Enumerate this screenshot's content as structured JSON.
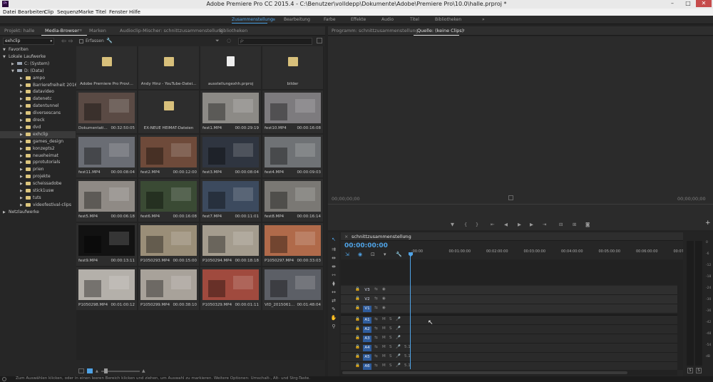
{
  "window": {
    "title": "Adobe Premiere Pro CC 2015.4 - C:\\Benutzer\\volldepp\\Dokumente\\Adobe\\Premiere Pro\\10.0\\halle.prproj *",
    "app_icon_label": "Pr",
    "minimize": "–",
    "maximize": "□",
    "close": "✕"
  },
  "menu": [
    "Datei",
    "Bearbeiten",
    "Clip",
    "Sequenz",
    "Marke",
    "Titel",
    "Fenster",
    "Hilfe"
  ],
  "workspaces": [
    "Zusammenstellung",
    "Bearbeitung",
    "Farbe",
    "Effekte",
    "Audio",
    "Titel",
    "Bibliotheken"
  ],
  "workspace_more": "»",
  "left_tabs": [
    "Projekt: halle",
    "Media-Browser",
    "Marken",
    "Audioclip-Mischer: schnittzusammenstellung",
    "Bibliotheken"
  ],
  "left_tab_menu": "≡",
  "right_tabs": [
    "Programm: schnittzusammenstellung",
    "Quelle: (keine Clips)"
  ],
  "right_tab_menu": "≡",
  "browser": {
    "path_value": "exhclip",
    "ingest_label": "Erfassen",
    "search_placeholder": "ρ·"
  },
  "tree": [
    {
      "label": "Favoriten",
      "level": 0,
      "arrow": "▼"
    },
    {
      "label": "Lokale Laufwerke",
      "level": 0,
      "arrow": "▼"
    },
    {
      "label": "C: (System)",
      "level": 1,
      "arrow": "▶"
    },
    {
      "label": "D: (Data)",
      "level": 1,
      "arrow": "▼"
    },
    {
      "label": "ampo",
      "level": 2,
      "arrow": "▶"
    },
    {
      "label": "Barrierefreiheit 2016",
      "level": 2,
      "arrow": "▶"
    },
    {
      "label": "datavideo",
      "level": 2,
      "arrow": "▶"
    },
    {
      "label": "datenetc",
      "level": 2,
      "arrow": "▶"
    },
    {
      "label": "datentunnel",
      "level": 2,
      "arrow": "▶"
    },
    {
      "label": "diversescans",
      "level": 2,
      "arrow": "▶"
    },
    {
      "label": "dreck",
      "level": 2,
      "arrow": "▶"
    },
    {
      "label": "dvd",
      "level": 2,
      "arrow": "▶"
    },
    {
      "label": "exhclip",
      "level": 2,
      "arrow": "▶",
      "selected": true
    },
    {
      "label": "games_design",
      "level": 2,
      "arrow": "▶"
    },
    {
      "label": "konzepts2",
      "level": 2,
      "arrow": "▶"
    },
    {
      "label": "neueheimat",
      "level": 2,
      "arrow": "▶"
    },
    {
      "label": "pprotutorials",
      "level": 2,
      "arrow": "▶"
    },
    {
      "label": "prien",
      "level": 2,
      "arrow": "▶"
    },
    {
      "label": "projekte",
      "level": 2,
      "arrow": "▶"
    },
    {
      "label": "scheissadobe",
      "level": 2,
      "arrow": "▶"
    },
    {
      "label": "stick1usw",
      "level": 2,
      "arrow": "▶"
    },
    {
      "label": "tuts",
      "level": 2,
      "arrow": "▶"
    },
    {
      "label": "videofestival-clips",
      "level": 2,
      "arrow": "▶"
    },
    {
      "label": "Netzlaufwerke",
      "level": 0,
      "arrow": "▶"
    }
  ],
  "items": [
    {
      "type": "folder",
      "name": "Adobe Premiere Pro Provi..."
    },
    {
      "type": "folder",
      "name": "Andy Hinz - YouTube-Datei..."
    },
    {
      "type": "project",
      "name": "ausstellungexhh.prproj"
    },
    {
      "type": "folder",
      "name": "bilder"
    },
    {
      "type": "clip",
      "name": "Dokumentati...",
      "dur": "00:32:50:05",
      "bg": "#5a4a44"
    },
    {
      "type": "folder",
      "name": "EX-NEUE HEIMAT-Dateien"
    },
    {
      "type": "clip",
      "name": "fest1.MP4",
      "dur": "00:00:29:19",
      "bg": "#8c8a86"
    },
    {
      "type": "clip",
      "name": "fest10.MP4",
      "dur": "00:00:16:08",
      "bg": "#7d7b7e"
    },
    {
      "type": "clip",
      "name": "fest11.MP4",
      "dur": "00:00:08:04",
      "bg": "#6a6d74"
    },
    {
      "type": "clip",
      "name": "fest2.MP4",
      "dur": "00:00:12:00",
      "bg": "#6e4a3a"
    },
    {
      "type": "clip",
      "name": "fest3.MP4",
      "dur": "00:00:08:04",
      "bg": "#2f3540"
    },
    {
      "type": "clip",
      "name": "fest4.MP4",
      "dur": "00:00:09:03",
      "bg": "#6f7275"
    },
    {
      "type": "clip",
      "name": "fest5.MP4",
      "dur": "00:00:06:18",
      "bg": "#8f8a85"
    },
    {
      "type": "clip",
      "name": "fest6.MP4",
      "dur": "00:00:16:08",
      "bg": "#3a4a34"
    },
    {
      "type": "clip",
      "name": "fest7.MP4",
      "dur": "00:00:11:01",
      "bg": "#3c4a5e"
    },
    {
      "type": "clip",
      "name": "fest8.MP4",
      "dur": "00:00:16:14",
      "bg": "#7a7874"
    },
    {
      "type": "clip",
      "name": "fest9.MP4",
      "dur": "00:00:13:11",
      "bg": "#121212"
    },
    {
      "type": "clip",
      "name": "P1050293.MP4",
      "dur": "00:00:15:00",
      "bg": "#9a8e78"
    },
    {
      "type": "clip",
      "name": "P1050294.MP4",
      "dur": "00:00:18:18",
      "bg": "#a49c8e"
    },
    {
      "type": "clip",
      "name": "P1050297.MP4",
      "dur": "00:00:33:03",
      "bg": "#b06a4a"
    },
    {
      "type": "clip",
      "name": "P1050298.MP4",
      "dur": "00:01:00:12",
      "bg": "#b4b0aa"
    },
    {
      "type": "clip",
      "name": "P1050299.MP4",
      "dur": "00:00:38:10",
      "bg": "#a8a29a"
    },
    {
      "type": "clip",
      "name": "P1050329.MP4",
      "dur": "00:00:01:11",
      "bg": "#a04a3e"
    },
    {
      "type": "clip",
      "name": "VID_2015061...",
      "dur": "00:01:48:04",
      "bg": "#5c5f66"
    }
  ],
  "monitor": {
    "tc_left": "00;00;00;00",
    "tc_right": "00;00;00;00",
    "add": "+"
  },
  "timeline": {
    "tab": "schnittzusammenstellung",
    "close": "×",
    "menu": "≡",
    "timecode": "00:00:00:00",
    "ruler": [
      ":00:00",
      "00:01:00:00",
      "00:02:00:00",
      "00:03:00:00",
      "00:04:00:00",
      "00:05:00:00",
      "00:06:00:00",
      "00:07:00:00"
    ],
    "video_tracks": [
      "V3",
      "V2",
      "V1"
    ],
    "audio_tracks": [
      "A1",
      "A2",
      "A3",
      "A4",
      "A5",
      "A6"
    ],
    "meter_scale": [
      "0",
      "-6",
      "-12",
      "-18",
      "-24",
      "-30",
      "-36",
      "-42",
      "-48",
      "-54",
      "dB"
    ],
    "meter_solo": [
      "S",
      "S"
    ]
  },
  "status": "Zum Auswählen klicken, oder in einen leeren Bereich klicken und ziehen, um Auswahl zu markieren. Weitere Optionen: Umschalt-, Alt- und Strg-Taste."
}
